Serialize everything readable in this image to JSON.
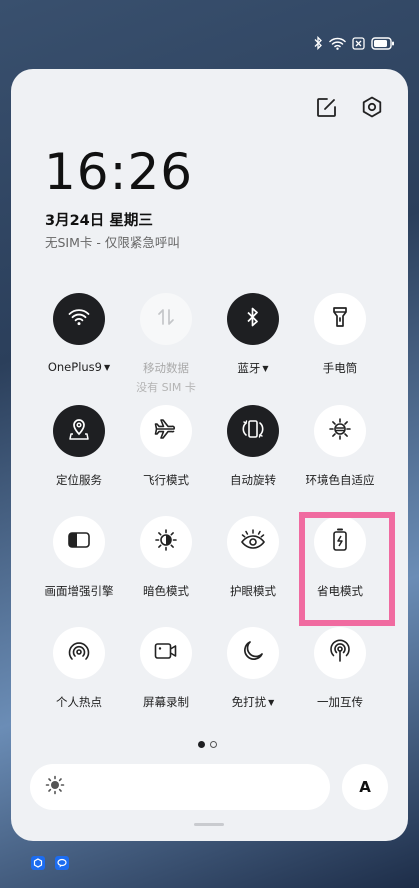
{
  "status_bar": {
    "icons": [
      "bluetooth-icon",
      "wifi-icon",
      "sim-off-icon",
      "battery-icon"
    ]
  },
  "header": {
    "icons": [
      "edit-icon",
      "settings-icon"
    ]
  },
  "clock": {
    "time": "16:26",
    "date": "3月24日  星期三",
    "sim_status": "无SIM卡 - 仅限紧急呼叫"
  },
  "tiles": [
    {
      "id": "wifi",
      "label": "OnePlus9",
      "has_caret": true,
      "state": "on",
      "icon": "wifi-icon"
    },
    {
      "id": "mobile-data",
      "label": "移动数据",
      "sub": "没有 SIM 卡",
      "state": "disabled",
      "icon": "mobile-data-icon"
    },
    {
      "id": "bluetooth",
      "label": "蓝牙",
      "has_caret": true,
      "state": "on",
      "icon": "bluetooth-icon"
    },
    {
      "id": "flashlight",
      "label": "手电筒",
      "state": "off",
      "icon": "flashlight-icon"
    },
    {
      "id": "location",
      "label": "定位服务",
      "state": "on",
      "icon": "location-icon"
    },
    {
      "id": "airplane",
      "label": "飞行模式",
      "state": "off",
      "icon": "airplane-icon"
    },
    {
      "id": "auto-rotate",
      "label": "自动旋转",
      "state": "on",
      "icon": "auto-rotate-icon"
    },
    {
      "id": "ambient-display",
      "label": "环境色自适应",
      "state": "off",
      "icon": "ambient-light-icon"
    },
    {
      "id": "screen-enhance",
      "label": "画面增强引擎",
      "state": "off",
      "icon": "screen-enhance-icon"
    },
    {
      "id": "dark-mode",
      "label": "暗色模式",
      "state": "off",
      "icon": "dark-mode-icon"
    },
    {
      "id": "eye-comfort",
      "label": "护眼模式",
      "state": "off",
      "icon": "eye-icon"
    },
    {
      "id": "battery-saver",
      "label": "省电模式",
      "state": "off",
      "icon": "battery-saver-icon"
    },
    {
      "id": "hotspot",
      "label": "个人热点",
      "state": "off",
      "icon": "hotspot-icon"
    },
    {
      "id": "screen-record",
      "label": "屏幕录制",
      "state": "off",
      "icon": "screen-record-icon"
    },
    {
      "id": "do-not-disturb",
      "label": "免打扰",
      "has_caret": true,
      "state": "off",
      "icon": "moon-icon"
    },
    {
      "id": "oneplus-share",
      "label": "一加互传",
      "state": "off",
      "icon": "share-signal-icon"
    }
  ],
  "highlight": {
    "target": "battery-saver",
    "color": "#f06ba0"
  },
  "pager": {
    "pages": 2,
    "current": 1
  },
  "brightness": {
    "icon": "sun-icon",
    "auto_label": "A"
  },
  "notifications": [
    "app-notification-icon",
    "chat-notification-icon"
  ]
}
